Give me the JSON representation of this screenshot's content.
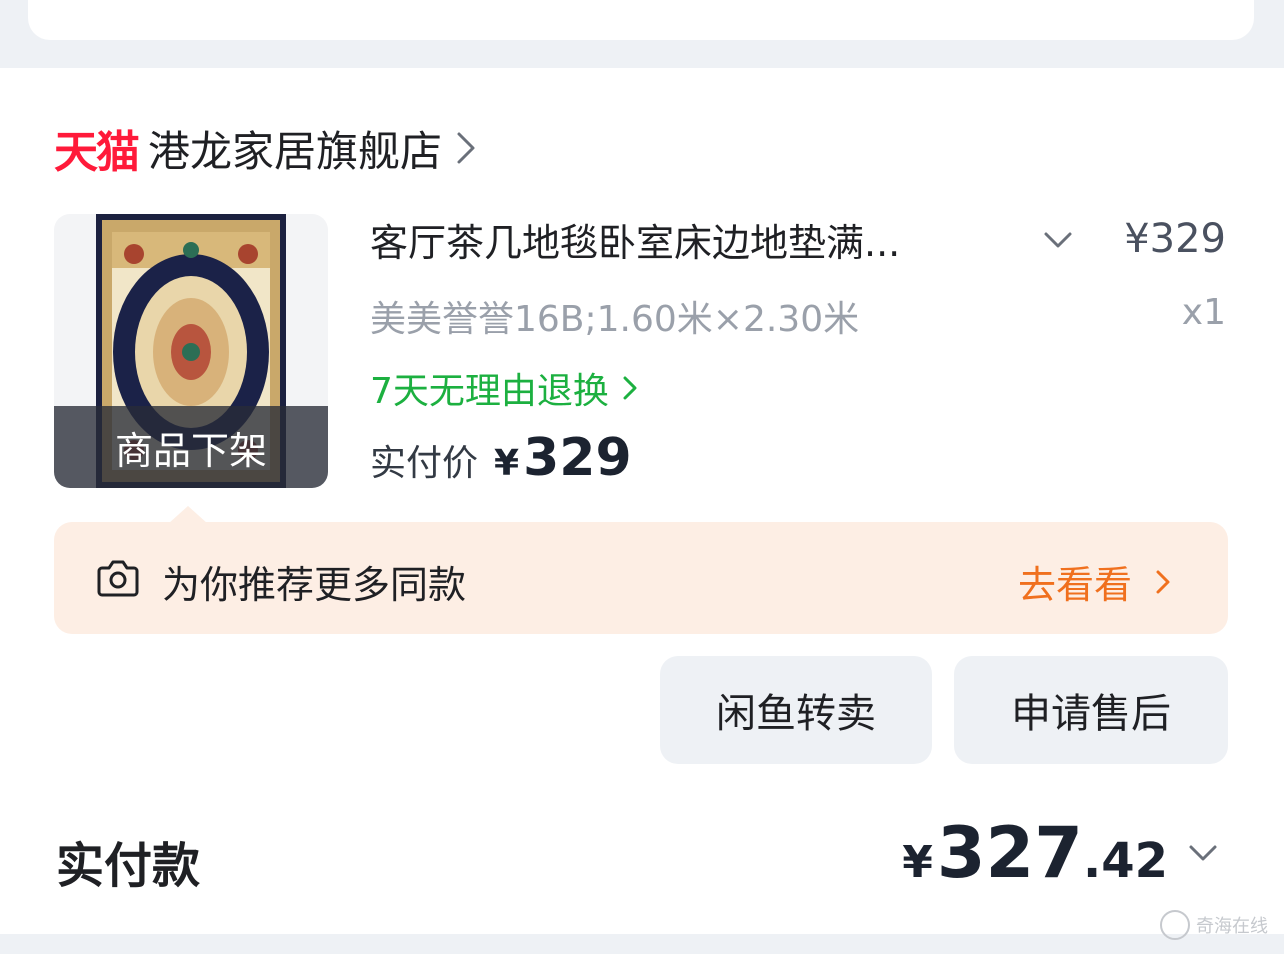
{
  "store": {
    "platform_logo": "天猫",
    "name": "港龙家居旗舰店",
    "arrow_icon": "chevron-right-icon"
  },
  "item": {
    "title": "客厅茶几地毯卧室床边地垫满...",
    "unit_price": "¥329",
    "sku": "美美誉誉16B;1.60米×2.30米",
    "quantity": "x1",
    "return_policy": "7天无理由退换",
    "paid_label": "实付价",
    "paid_symbol": "¥",
    "paid_value": "329",
    "thumbnail_overlay": "商品下架"
  },
  "recommend": {
    "text": "为你推荐更多同款",
    "action": "去看看",
    "icon": "camera-icon"
  },
  "buttons": {
    "resell": "闲鱼转卖",
    "after_sale": "申请售后"
  },
  "total": {
    "label": "实付款",
    "symbol": "¥",
    "integer": "327",
    "decimal": ".42"
  },
  "watermark": "奇海在线",
  "colors": {
    "tmall_red": "#ff1a3a",
    "green": "#1cb040",
    "orange": "#f0701e",
    "rec_bg": "#fdeee4"
  }
}
